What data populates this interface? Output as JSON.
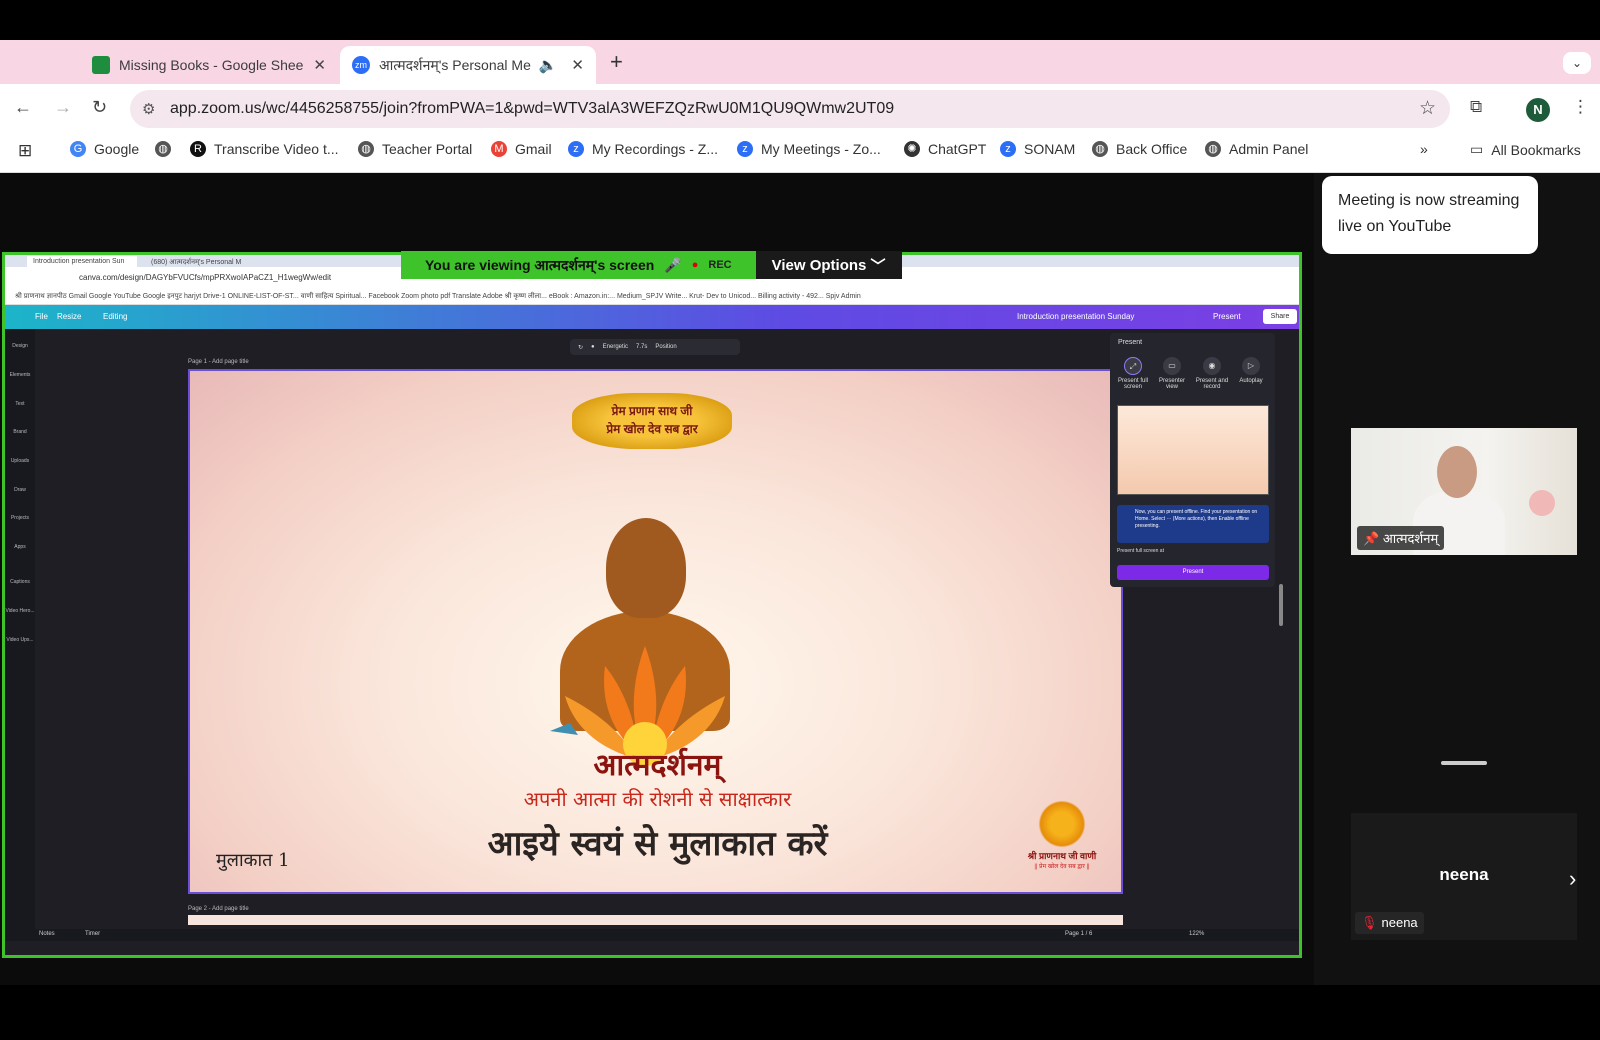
{
  "browser": {
    "tabs": [
      {
        "label": "Missing Books - Google Shee",
        "active": false
      },
      {
        "label": "आत्मदर्शनम्'s Personal Meeti",
        "active": true
      }
    ],
    "url": "app.zoom.us/wc/4456258755/join?fromPWA=1&pwd=WTV3alA3WEFZQzRwU0M1QU9QWmw2UT09",
    "profile_initial": "N",
    "bookmarks": [
      "Google",
      "Transcribe Video t...",
      "Teacher Portal",
      "Gmail",
      "My Recordings - Z...",
      "My Meetings - Zo...",
      "ChatGPT",
      "SONAM",
      "Back Office",
      "Admin Panel"
    ],
    "all_bookmarks": "All Bookmarks"
  },
  "zoom": {
    "viewing_banner": "You are viewing  आत्मदर्शनम्'s screen",
    "rec_label": "REC",
    "view_options": "View Options",
    "stream_toast": "Meeting is now streaming live on YouTube",
    "participants": [
      {
        "name": "आत्मदर्शनम्",
        "video": true
      },
      {
        "name": "neena",
        "video": false,
        "big_label": "neena"
      }
    ]
  },
  "shared_screen": {
    "tab_labels": [
      "Introduction presentation Sun",
      "(680) आत्मदर्शनम्'s Personal M"
    ],
    "url": "canva.com/design/DAGYbFVUCfs/mpPRXwoIAPaCZ1_H1wegWw/edit",
    "bookmarks_line": "श्री प्राणनाथ ज्ञानपीठ  Gmail  Google  YouTube  Google इनपुट  harjyt  Drive-1  ONLINE-LIST-OF-ST...  वाणी साहित्य Spiritual...  Facebook  Zoom  photo  pdf  Translate  Adobe  श्री कृष्ण लीला...  eBook : Amazon.in:...  Medium_SPJV Write...  Krut- Dev to Unicod...  Billing activity - 492...  Spjv Admin",
    "canva_menu": [
      "File",
      "Resize",
      "Editing"
    ],
    "design_title": "Introduction presentation Sunday",
    "present_label": "Present",
    "share_label": "Share",
    "left_rail": [
      "Design",
      "Elements",
      "Text",
      "Brand",
      "Uploads",
      "Draw",
      "Projects",
      "Apps",
      "Captions",
      "Video Hero...",
      "Video Ups..."
    ],
    "float_toolbar": [
      "Energetic",
      "7.7s",
      "Position"
    ],
    "page1_label": "Page 1 - Add page title",
    "page2_label": "Page 2 - Add page title",
    "slide": {
      "banner_line1": "प्रेम प्रणाम साथ जी",
      "banner_line2": "प्रेम खोल देव सब द्वार",
      "title": "आत्मदर्शनम्",
      "subtitle": "अपनी आत्मा की रोशनी से साक्षात्कार",
      "headline": "आइये स्वयं से मुलाकात करें",
      "corner_text": "मुलाकात 1",
      "logo_text": "श्री प्राणनाथ जी वाणी",
      "logo_sub": "|| प्रेम खोल देव सब द्वार ||"
    },
    "present_panel": {
      "header": "Present",
      "options": [
        "Present full screen",
        "Presenter view",
        "Present and record",
        "Autoplay"
      ],
      "info": "Now, you can present offline. Find your presentation on Home. Select ··· (More actions), then Enable offline presenting.",
      "shortcut_label": "Present full screen at",
      "button": "Present"
    },
    "bottom_bar": {
      "notes": "Notes",
      "timer": "Timer",
      "page": "Page 1 / 6",
      "zoom": "122%"
    }
  }
}
